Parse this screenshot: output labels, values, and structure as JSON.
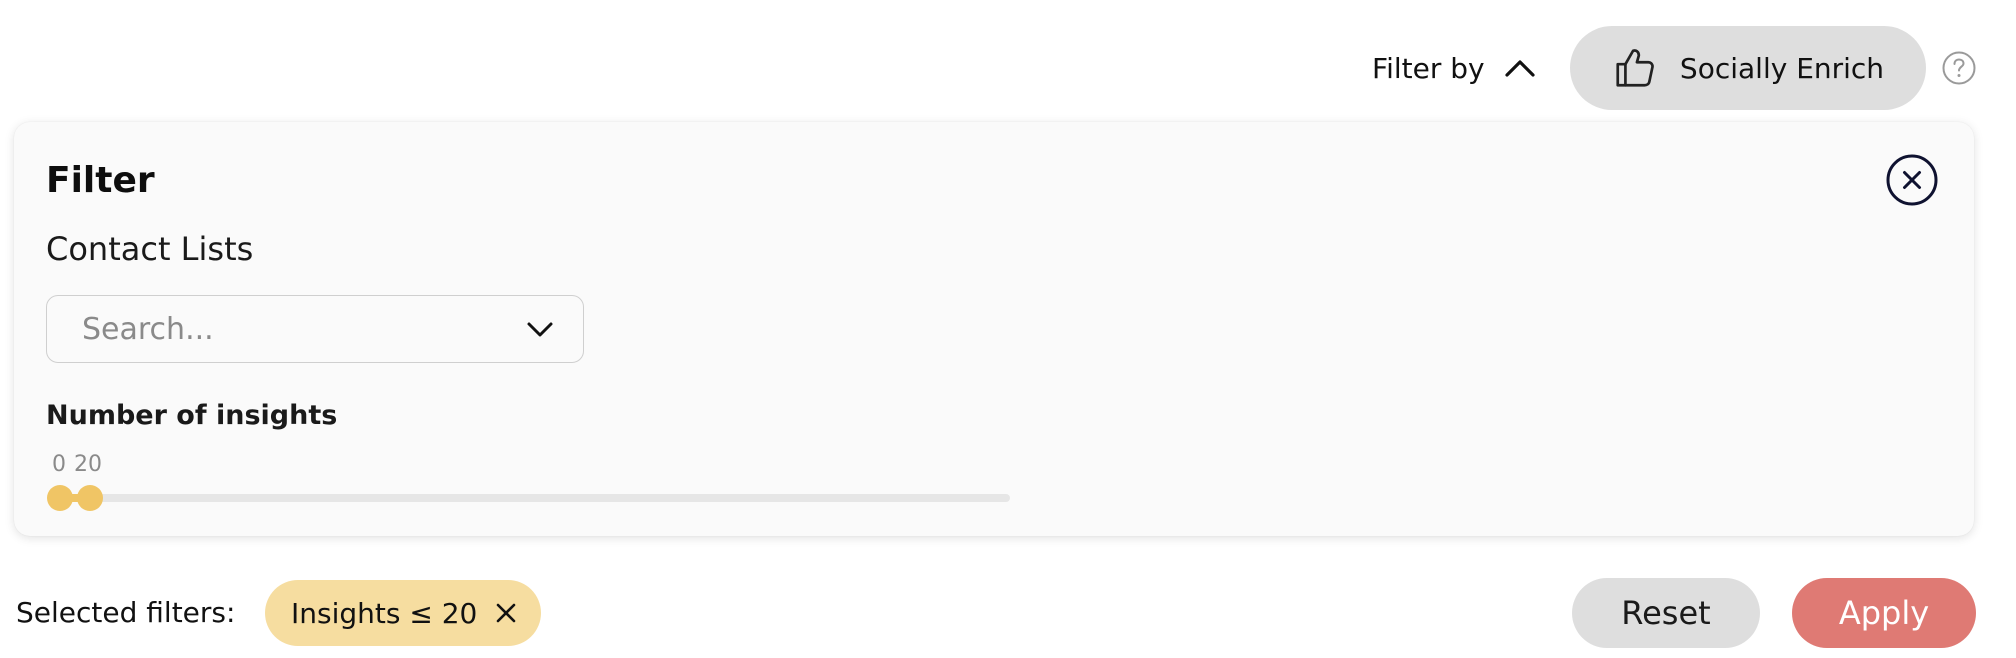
{
  "header": {
    "filter_by_label": "Filter by",
    "filter_by_icon": "chevron-up-icon",
    "enrich_label": "Socially Enrich",
    "enrich_icon": "thumbs-up-icon",
    "help_icon": "question-circle-icon"
  },
  "filter_panel": {
    "title": "Filter",
    "close_icon": "close-circle-icon",
    "contact_lists": {
      "label": "Contact Lists",
      "placeholder": "Search...",
      "value": "",
      "icon": "chevron-down-icon"
    },
    "insights": {
      "label": "Number of insights",
      "range_min_value": "0",
      "range_max_value": "20",
      "accent_color": "#f0c565"
    }
  },
  "footer": {
    "selected_label": "Selected filters:",
    "chips": [
      {
        "label": "Insights ≤ 20",
        "remove_icon": "close-icon"
      }
    ],
    "reset_label": "Reset",
    "apply_label": "Apply"
  },
  "colors": {
    "chip_bg": "#f6dda0",
    "apply_bg": "#df7a74",
    "neutral_button_bg": "#dedede",
    "panel_bg": "#fafafa"
  }
}
